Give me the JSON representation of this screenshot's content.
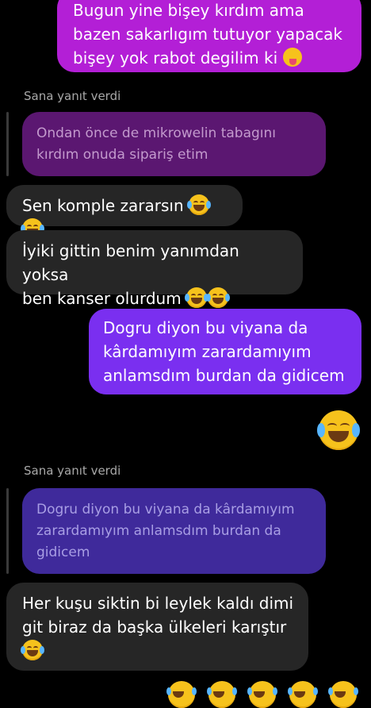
{
  "messages": {
    "m1": {
      "lines": [
        "Bugun yine bişey kırdım ama",
        "bazen sakarlıgım tutuyor yapacak",
        "bişey yok rabot degilim ki"
      ]
    },
    "reply1": {
      "label": "Sana yanıt verdi",
      "quote_lines": [
        "Ondan önce de mikrowelin tabagını",
        "kırdım onuda sipariş etim"
      ]
    },
    "m2": {
      "text": "Sen komple zararsın"
    },
    "m3": {
      "lines": [
        "İyiki gittin benim yanımdan yoksa",
        "ben kanser olurdum"
      ]
    },
    "m4": {
      "lines": [
        "Dogru diyon bu viyana da",
        "kârdamıyım zarardamıyım",
        "anlamsdım burdan da gidicem"
      ]
    },
    "reply2": {
      "label": "Sana yanıt verdi",
      "quote_lines": [
        "Dogru diyon bu viyana da kârdamıyım",
        "zarardamıyım anlamsdım burdan da",
        "gidicem"
      ]
    },
    "m5": {
      "lines": [
        "Her kuşu siktin bi leylek kaldı dimi",
        "git biraz da başka ülkeleri karıştır"
      ]
    }
  },
  "emojis": {
    "laugh": "face-with-tears-of-joy",
    "wink": "face-savoring-food"
  },
  "colors": {
    "outgoing_pink": "#b31fd6",
    "outgoing_purple": "#7a2ff0",
    "incoming": "#262626",
    "background": "#000000"
  }
}
